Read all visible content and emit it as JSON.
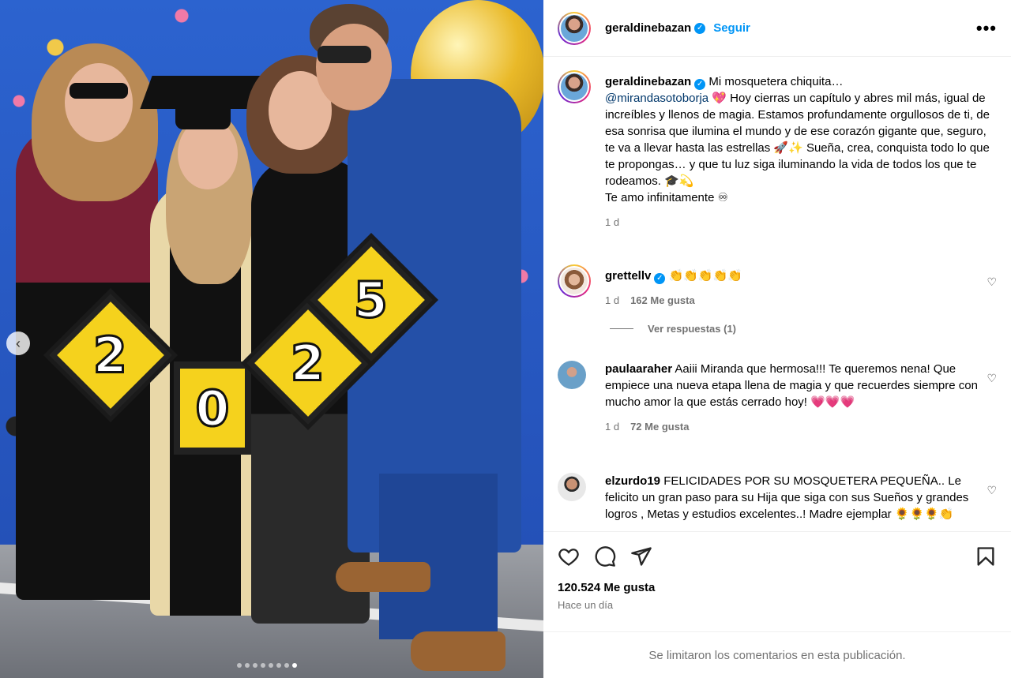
{
  "post": {
    "author": "geraldinebazan",
    "follow_label": "Seguir",
    "more_glyph": "•••",
    "caption": {
      "username": "geraldinebazan",
      "line1": " Mi mosquetera chiquita…",
      "mention": "@mirandasotoborja",
      "text": " 💖 Hoy cierras un capítulo y abres mil más, igual de increíbles y llenos de magia. Estamos profundamente orgullosos de ti, de esa sonrisa que ilumina el mundo y de ese corazón gigante que, seguro, te va a llevar hasta las estrellas 🚀✨ Sueña, crea, conquista todo lo que te propongas… y que tu luz siga iluminando la vida de todos los que te rodeamos. 🎓💫",
      "closing": "Te amo infinitamente ♾",
      "time": "1 d"
    }
  },
  "comments": [
    {
      "username": "grettellv",
      "verified": true,
      "text": " 👏👏👏👏👏",
      "time": "1 d",
      "likes": "162 Me gusta",
      "replies_label": "Ver respuestas (1)"
    },
    {
      "username": "paulaaraher",
      "text": " Aaiii Miranda que hermosa!!! Te queremos nena! Que empiece una nueva etapa llena de magia y que recuerdes siempre con mucho amor la que estás cerrado hoy! 💗💗💗",
      "time": "1 d",
      "likes": "72 Me gusta"
    },
    {
      "username": "elzurdo19",
      "text": " FELICIDADES POR SU MOSQUETERA PEQUEÑA.. Le felicito un gran paso para su Hija que siga con sus Sueños y grandes logros , Metas y estudios excelentes..! Madre ejemplar 🌻🌻🌻👏"
    }
  ],
  "actions": {
    "icons": [
      "heart-icon",
      "comment-icon",
      "share-icon",
      "save-icon"
    ],
    "likes": "120.524 Me gusta",
    "time_ago": "Hace un día",
    "comments_limited": "Se limitaron los comentarios en esta publicación."
  },
  "photo": {
    "sign_digits": [
      "2",
      "0",
      "2",
      "5"
    ],
    "carousel_count": 8,
    "carousel_active": 7
  }
}
